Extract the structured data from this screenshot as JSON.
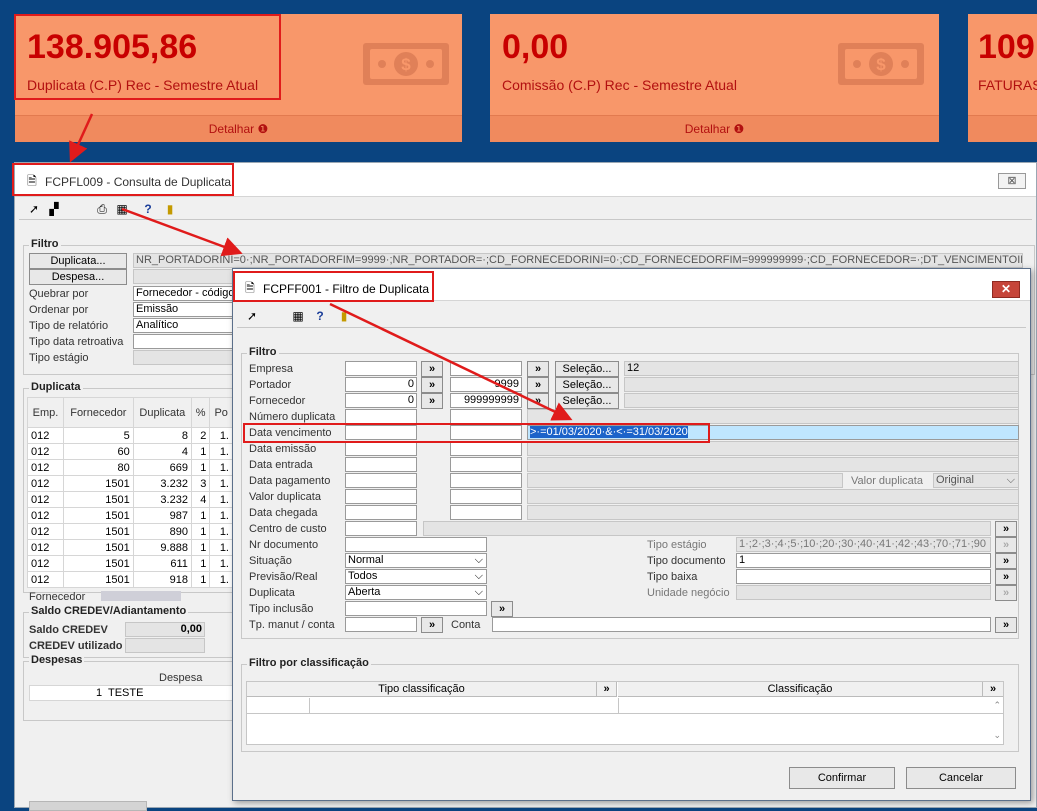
{
  "cards": [
    {
      "value": "138.905,86",
      "label": "Duplicata (C.P) Rec - Semestre Atual",
      "footer": "Detalhar"
    },
    {
      "value": "0,00",
      "label": "Comissão (C.P) Rec - Semestre Atual",
      "footer": "Detalhar"
    },
    {
      "value": "109",
      "label": "FATURAS"
    }
  ],
  "colors": {
    "card": "#f8976a",
    "value": "#c80000",
    "highlight": "#e01b1b",
    "selection": "#bfe6ff"
  },
  "window1": {
    "title": "FCPFL009 - Consulta de Duplicata",
    "close_label": "⊠",
    "filtro_title": "Filtro",
    "btn_duplicata": "Duplicata...",
    "btn_despesa": "Despesa...",
    "filter_text": "NR_PORTADORINI=0·;NR_PORTADORFIM=9999·;NR_PORTADOR=·;CD_FORNECEDORINI=0·;CD_FORNECEDORFIM=999999999·;CD_FORNECEDOR=·;DT_VENCIMENTOINI=·;DT_VENCIME",
    "fields": [
      {
        "label": "Quebrar por",
        "value": "Fornecedor - código"
      },
      {
        "label": "Ordenar por",
        "value": "Emissão"
      },
      {
        "label": "Tipo de relatório",
        "value": "Analítico"
      },
      {
        "label": "Tipo data retroativa",
        "value": ""
      },
      {
        "label": "Tipo estágio",
        "value": ""
      }
    ],
    "duplicata_title": "Duplicata",
    "grid_headers": [
      "Emp.",
      "Fornecedor",
      "Duplicata",
      "%",
      "",
      "Po"
    ],
    "grid_rows": [
      [
        "012",
        "5",
        "8",
        "2",
        "1."
      ],
      [
        "012",
        "60",
        "4",
        "1",
        "1."
      ],
      [
        "012",
        "80",
        "669",
        "1",
        "1."
      ],
      [
        "012",
        "1501",
        "3.232",
        "3",
        "1."
      ],
      [
        "012",
        "1501",
        "3.232",
        "4",
        "1."
      ],
      [
        "012",
        "1501",
        "987",
        "1",
        "1."
      ],
      [
        "012",
        "1501",
        "890",
        "1",
        "1."
      ],
      [
        "012",
        "1501",
        "9.888",
        "1",
        "1."
      ],
      [
        "012",
        "1501",
        "611",
        "1",
        "1."
      ],
      [
        "012",
        "1501",
        "918",
        "1",
        "1."
      ]
    ],
    "fornecedor_label": "Fornecedor",
    "saldo_title": "Saldo CREDEV/Adiantamento",
    "saldo_credev_label": "Saldo CREDEV",
    "saldo_credev_value": "0,00",
    "credev_utilizado_label": "CREDEV utilizado",
    "despesas_title": "Despesas",
    "despesa_header": "Despesa",
    "despesa_row_num": "1",
    "despesa_row_text": "TESTE"
  },
  "window2": {
    "title": "FCPFF001 - Filtro de Duplicata",
    "close_label": "✕",
    "filtro_title": "Filtro",
    "empresa_label": "Empresa",
    "empresa_value": "12",
    "portador_label": "Portador",
    "portador_ini": "0",
    "portador_fim": "9999",
    "fornecedor_label": "Fornecedor",
    "fornecedor_ini": "0",
    "fornecedor_fim": "999999999",
    "selecao_label": "Seleção...",
    "arrow_label": "»",
    "numero_duplicata_label": "Número duplicata",
    "data_vencimento_label": "Data vencimento",
    "data_vencimento_value": ">·=01/03/2020·&·<·=31/03/2020",
    "data_emissao_label": "Data emissão",
    "data_entrada_label": "Data entrada",
    "data_pagamento_label": "Data pagamento",
    "valor_duplicata_label": "Valor duplicata",
    "valor_duplicata_right_label": "Valor duplicata",
    "valor_duplicata_select": "Original",
    "data_chegada_label": "Data chegada",
    "centro_custo_label": "Centro de custo",
    "nr_documento_label": "Nr documento",
    "tipo_estagio_label": "Tipo estágio",
    "tipo_estagio_value": "1·;2·;3·;4·;5·;10·;20·;30·;40·;41·;42·;43·;70·;71·;90",
    "situacao_label": "Situação",
    "situacao_value": "Normal",
    "tipo_documento_label": "Tipo documento",
    "tipo_documento_value": "1",
    "previsao_label": "Previsão/Real",
    "previsao_value": "Todos",
    "tipo_baixa_label": "Tipo baixa",
    "duplicata_label": "Duplicata",
    "duplicata_value": "Aberta",
    "unidade_negocio_label": "Unidade negócio",
    "tipo_inclusao_label": "Tipo inclusão",
    "tp_manut_label": "Tp. manut / conta",
    "conta_label": "Conta",
    "classificacao_title": "Filtro por classificação",
    "col_tipo": "Tipo classificação",
    "col_class": "Classificação",
    "confirmar_label": "Confirmar",
    "cancelar_label": "Cancelar"
  }
}
